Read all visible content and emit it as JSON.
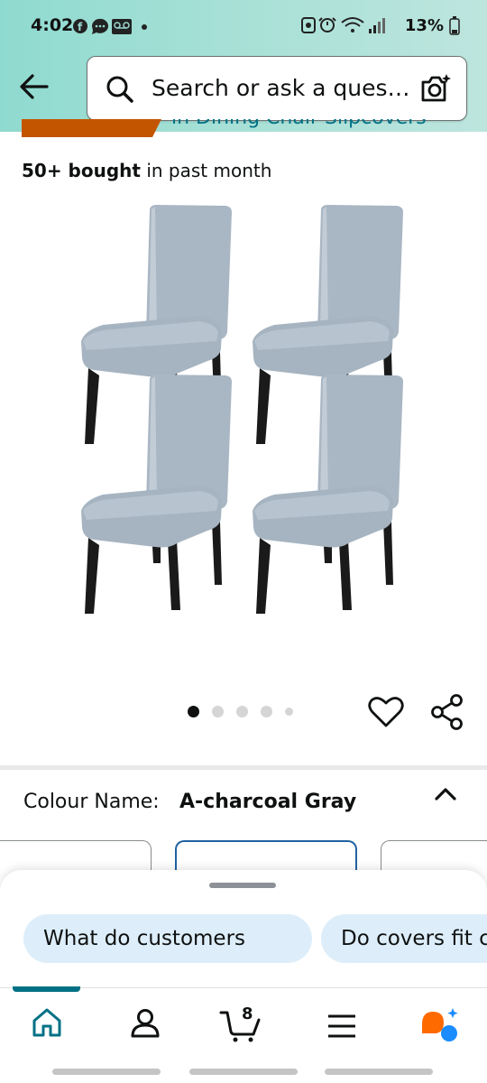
{
  "status_bar": {
    "time": "4:02",
    "battery_percent": "13%",
    "left_icons": [
      "facebook-icon",
      "messenger-icon",
      "voicemail-icon",
      "dot-icon"
    ],
    "right_icons": [
      "alarm-clock-icon",
      "alarm-icon",
      "wifi-icon",
      "signal-icon",
      "battery-icon"
    ]
  },
  "header": {
    "back_icon": "arrow-left-icon",
    "search_placeholder": "Search or ask a ques…",
    "search_icon": "search-icon",
    "camera_icon": "camera-search-icon",
    "background_gradient": [
      "#8fdad0",
      "#bde5de"
    ]
  },
  "product": {
    "clipped_text": "in Dining Chair Slipcovers",
    "badge_color": "#c45500",
    "bought_bold": "50+ bought",
    "bought_rest": " in past month",
    "image_subject": "four light grey chair slipcovers on chairs with black legs",
    "carousel": {
      "total": 5,
      "active": 0
    },
    "actions": [
      "heart-icon",
      "share-icon"
    ]
  },
  "variant": {
    "label": "Colour Name:",
    "value": "A-charcoal Gray",
    "toggle_icon": "chevron-up-icon"
  },
  "sheet": {
    "chips": [
      "What do customers",
      "Do covers fit c"
    ]
  },
  "bottom_nav": {
    "items": [
      "home-icon",
      "account-icon",
      "cart-icon",
      "menu-icon",
      "rufus-icon"
    ],
    "cart_count": "8",
    "active_color": "#007185"
  }
}
